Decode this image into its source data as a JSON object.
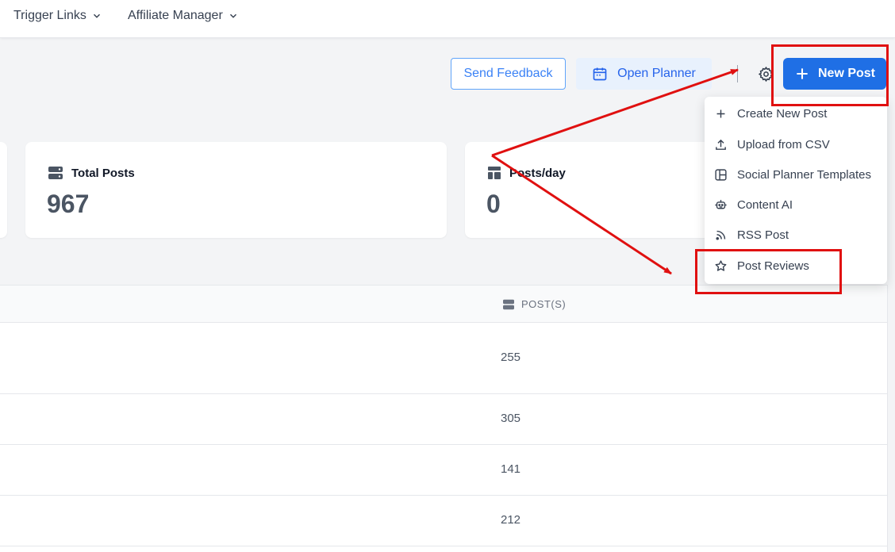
{
  "nav": {
    "items": [
      {
        "label": "Trigger Links"
      },
      {
        "label": "Affiliate Manager"
      }
    ]
  },
  "toolbar": {
    "feedback_label": "Send Feedback",
    "planner_label": "Open Planner",
    "new_post_label": "New Post"
  },
  "stats": {
    "total_posts": {
      "label": "Total Posts",
      "value": "967"
    },
    "posts_per_day": {
      "label": "Posts/day",
      "value": "0"
    }
  },
  "table": {
    "posts_header": "POST(S)",
    "rows": [
      {
        "posts": "255"
      },
      {
        "posts": "305"
      },
      {
        "posts": "141"
      },
      {
        "posts": "212"
      }
    ]
  },
  "menu": {
    "items": [
      {
        "label": "Create New Post",
        "icon": "plus-icon"
      },
      {
        "label": "Upload from CSV",
        "icon": "upload-icon"
      },
      {
        "label": "Social Planner Templates",
        "icon": "template-icon"
      },
      {
        "label": "Content AI",
        "icon": "robot-icon"
      },
      {
        "label": "RSS Post",
        "icon": "rss-icon"
      },
      {
        "label": "Post Reviews",
        "icon": "star-icon"
      }
    ]
  },
  "colors": {
    "primary": "#1f6fe5",
    "annotation": "#e01010",
    "page_bg": "#f3f4f6"
  }
}
